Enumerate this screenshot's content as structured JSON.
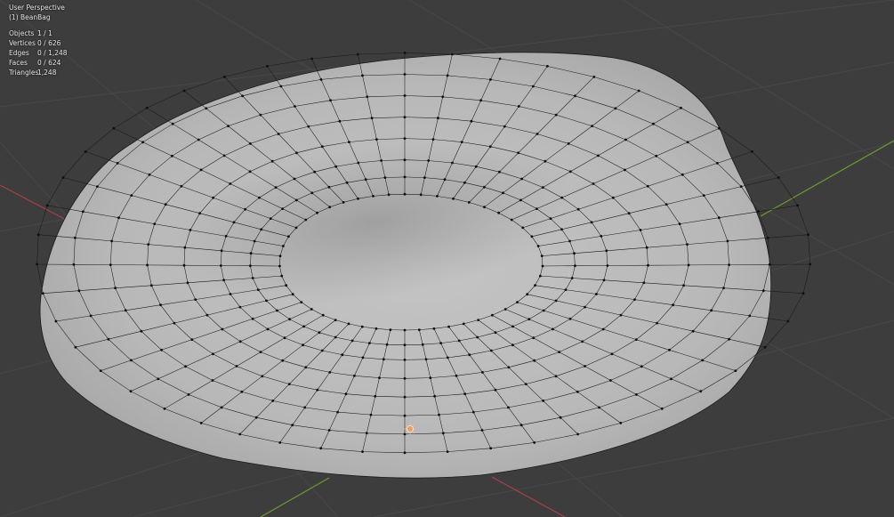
{
  "viewport": {
    "view_name": "User Perspective",
    "active_object": "(1) BeanBag",
    "stats": [
      {
        "label": "Objects",
        "value": "1 / 1"
      },
      {
        "label": "Vertices",
        "value": "0 / 626"
      },
      {
        "label": "Edges",
        "value": "0 / 1,248"
      },
      {
        "label": "Faces",
        "value": "0 / 624"
      },
      {
        "label": "Triangles",
        "value": "1,248"
      }
    ]
  },
  "colors": {
    "background": "#3d3d3d",
    "grid": "#484848",
    "x_axis": "#a8404a",
    "y_axis": "#6e9a2c",
    "mesh_surface": "#bdbdbd",
    "wire": "#1a1a1a"
  },
  "icons": {
    "origin": "object-origin-icon",
    "mesh": "beanbag-mesh"
  }
}
